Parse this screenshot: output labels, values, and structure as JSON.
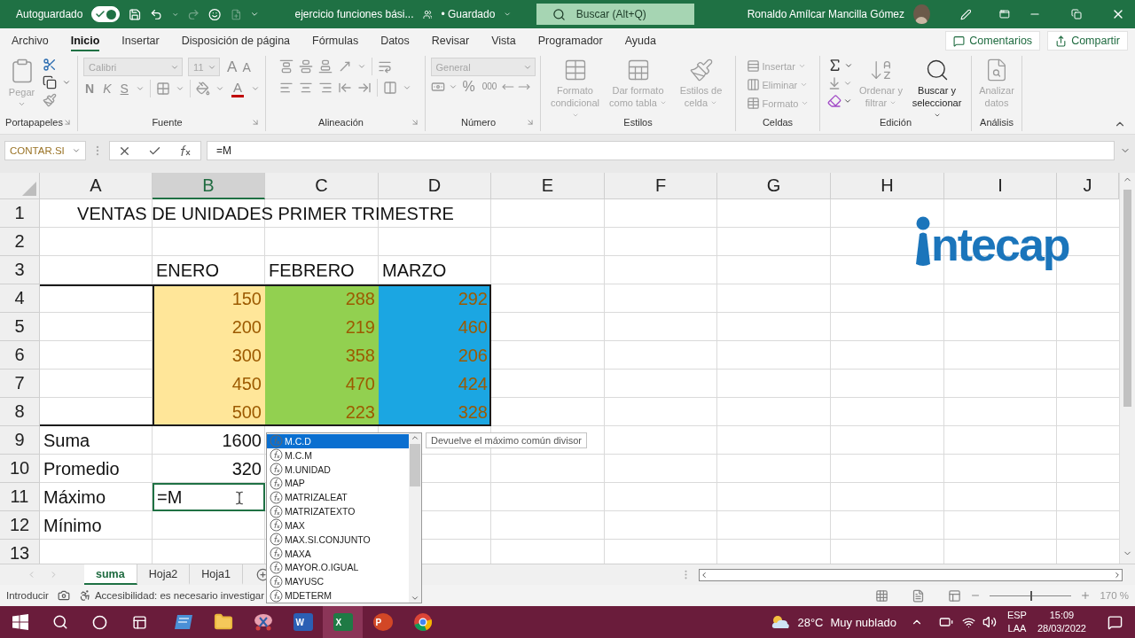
{
  "title_bar": {
    "autosave_label": "Autoguardado",
    "autosave_on": true,
    "file_name": "ejercicio funciones bási...",
    "save_status": "• Guardado",
    "search_placeholder": "Buscar (Alt+Q)",
    "user_name": "Ronaldo Amílcar Mancilla Gómez"
  },
  "ribbon_tabs": [
    {
      "label": "Archivo",
      "selected": false
    },
    {
      "label": "Inicio",
      "selected": true
    },
    {
      "label": "Insertar",
      "selected": false
    },
    {
      "label": "Disposición de página",
      "selected": false
    },
    {
      "label": "Fórmulas",
      "selected": false
    },
    {
      "label": "Datos",
      "selected": false
    },
    {
      "label": "Revisar",
      "selected": false
    },
    {
      "label": "Vista",
      "selected": false
    },
    {
      "label": "Programador",
      "selected": false
    },
    {
      "label": "Ayuda",
      "selected": false
    }
  ],
  "comments_button": "Comentarios",
  "share_button": "Compartir",
  "ribbon": [
    {
      "kind": "clipboard",
      "label": "Portapapeles",
      "disabled": true,
      "commands": [
        "Pegar"
      ]
    },
    {
      "kind": "font",
      "label": "Fuente",
      "disabled": true,
      "font_name": "Calibri",
      "font_size": "11",
      "glyphs": {
        "grow": "A",
        "shrink": "A",
        "bold": "N",
        "italic": "K",
        "underline": "S",
        "font_color": "A"
      }
    },
    {
      "kind": "alignment",
      "label": "Alineación",
      "disabled": true
    },
    {
      "kind": "number",
      "label": "Número",
      "disabled": true,
      "format": "General",
      "glyphs": {
        "percent": "%",
        "thousands": "000"
      }
    },
    {
      "kind": "styles",
      "label": "Estilos",
      "commands": [
        {
          "label": "Formato condicional",
          "disabled": true
        },
        {
          "label": "Dar formato como tabla",
          "disabled": true
        },
        {
          "label": "Estilos de celda",
          "disabled": true
        }
      ]
    },
    {
      "kind": "cells",
      "label": "Celdas",
      "commands": [
        {
          "label": "Insertar",
          "disabled": true
        },
        {
          "label": "Eliminar",
          "disabled": true
        },
        {
          "label": "Formato",
          "disabled": true
        }
      ]
    },
    {
      "kind": "editing",
      "label": "Edición",
      "commands": [
        {
          "label": "Ordenar y filtrar",
          "disabled": true
        },
        {
          "label": "Buscar y seleccionar",
          "disabled": false
        }
      ]
    },
    {
      "kind": "analysis",
      "label": "Análisis",
      "commands": [
        {
          "label": "Analizar datos",
          "disabled": true
        }
      ]
    }
  ],
  "formula_bar": {
    "name_box": "CONTAR.SI",
    "formula": "=M"
  },
  "columns": [
    {
      "label": "A",
      "selected": false
    },
    {
      "label": "B",
      "selected": true
    },
    {
      "label": "C",
      "selected": false
    },
    {
      "label": "D",
      "selected": false
    },
    {
      "label": "E",
      "selected": false
    },
    {
      "label": "F",
      "selected": false
    },
    {
      "label": "G",
      "selected": false
    },
    {
      "label": "H",
      "selected": false
    },
    {
      "label": "I",
      "selected": false
    },
    {
      "label": "J",
      "selected": false
    }
  ],
  "rows": [
    {
      "label": "1",
      "cells": [
        {
          "kind": "title",
          "text": "VENTAS DE UNIDADES PRIMER TRIMESTRE"
        }
      ]
    },
    {
      "label": "2"
    },
    {
      "label": "3",
      "cells": [
        {
          "kind": "blank"
        },
        {
          "kind": "text",
          "text": "ENERO"
        },
        {
          "kind": "text",
          "text": "FEBRERO"
        },
        {
          "kind": "text",
          "text": "MARZO"
        }
      ]
    },
    {
      "label": "4",
      "cells": [
        {
          "kind": "blank"
        },
        {
          "kind": "number",
          "text": "150",
          "color": "#ffe699"
        },
        {
          "kind": "number",
          "text": "288",
          "color": "#92d050"
        },
        {
          "kind": "number",
          "text": "292",
          "color": "#1ba6e2"
        }
      ]
    },
    {
      "label": "5",
      "cells": [
        {
          "kind": "blank"
        },
        {
          "kind": "number",
          "text": "200",
          "color": "#ffe699"
        },
        {
          "kind": "number",
          "text": "219",
          "color": "#92d050"
        },
        {
          "kind": "number",
          "text": "460",
          "color": "#1ba6e2"
        }
      ]
    },
    {
      "label": "6",
      "cells": [
        {
          "kind": "blank"
        },
        {
          "kind": "number",
          "text": "300",
          "color": "#ffe699"
        },
        {
          "kind": "number",
          "text": "358",
          "color": "#92d050"
        },
        {
          "kind": "number",
          "text": "206",
          "color": "#1ba6e2"
        }
      ]
    },
    {
      "label": "7",
      "cells": [
        {
          "kind": "blank"
        },
        {
          "kind": "number",
          "text": "450",
          "color": "#ffe699"
        },
        {
          "kind": "number",
          "text": "470",
          "color": "#92d050"
        },
        {
          "kind": "number",
          "text": "424",
          "color": "#1ba6e2"
        }
      ]
    },
    {
      "label": "8",
      "cells": [
        {
          "kind": "blank"
        },
        {
          "kind": "number",
          "text": "500",
          "color": "#ffe699"
        },
        {
          "kind": "number",
          "text": "223",
          "color": "#92d050"
        },
        {
          "kind": "number",
          "text": "328",
          "color": "#1ba6e2"
        }
      ]
    },
    {
      "label": "9",
      "cells": [
        {
          "kind": "text",
          "text": "Suma"
        },
        {
          "kind": "total",
          "text": "1600"
        }
      ]
    },
    {
      "label": "10",
      "cells": [
        {
          "kind": "text",
          "text": "Promedio"
        },
        {
          "kind": "total",
          "text": "320"
        }
      ]
    },
    {
      "label": "11",
      "cells": [
        {
          "kind": "text",
          "text": "Máximo"
        },
        {
          "kind": "editing",
          "text": "=M"
        }
      ]
    },
    {
      "label": "12",
      "cells": [
        {
          "kind": "text",
          "text": "Mínimo"
        }
      ]
    },
    {
      "label": "13"
    }
  ],
  "logo_text": "ntecap",
  "autocomplete": {
    "items": [
      {
        "label": "M.C.D",
        "selected": true
      },
      {
        "label": "M.C.M",
        "selected": false
      },
      {
        "label": "M.UNIDAD",
        "selected": false
      },
      {
        "label": "MAP",
        "selected": false
      },
      {
        "label": "MATRIZALEAT",
        "selected": false
      },
      {
        "label": "MATRIZATEXTO",
        "selected": false
      },
      {
        "label": "MAX",
        "selected": false
      },
      {
        "label": "MAX.SI.CONJUNTO",
        "selected": false
      },
      {
        "label": "MAXA",
        "selected": false
      },
      {
        "label": "MAYOR.O.IGUAL",
        "selected": false
      },
      {
        "label": "MAYUSC",
        "selected": false
      },
      {
        "label": "MDETERM",
        "selected": false
      }
    ],
    "tooltip": "Devuelve el máximo común divisor"
  },
  "sheet_tabs": [
    {
      "label": "suma",
      "selected": true
    },
    {
      "label": "Hoja2",
      "selected": false
    },
    {
      "label": "Hoja1",
      "selected": false
    }
  ],
  "status_bar": {
    "mode": "Introducir",
    "accessibility": "Accesibilidad: es necesario investigar",
    "zoom": "170 %",
    "zoom_slider": {
      "level": 0.5
    }
  },
  "taskbar": {
    "apps": [
      {
        "kind": "board",
        "selected": false
      },
      {
        "kind": "folder",
        "selected": false
      },
      {
        "kind": "snip",
        "selected": false
      },
      {
        "kind": "document",
        "badge": "W",
        "selected": false
      },
      {
        "kind": "spreadsheet",
        "badge": "X",
        "selected": true
      },
      {
        "kind": "slides",
        "badge": "P",
        "selected": false
      },
      {
        "kind": "browser",
        "selected": false
      }
    ],
    "temperature": "28°C",
    "weather": "Muy nublado",
    "language": "ESP",
    "layout": "LAA",
    "time": "15:09",
    "date": "28/03/2022"
  }
}
